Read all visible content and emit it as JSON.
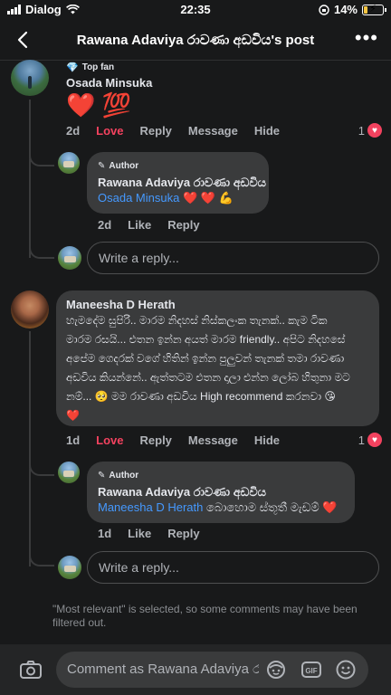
{
  "status_bar": {
    "carrier": "Dialog",
    "time": "22:35",
    "battery": "14%"
  },
  "header": {
    "title": "Rawana Adaviya රාවණා අඩවිය's post"
  },
  "comments": [
    {
      "badge": "Top fan",
      "author": "Osada Minsuka",
      "text": "❤️ 💯",
      "time": "2d",
      "actions": {
        "love": "Love",
        "reply": "Reply",
        "message": "Message",
        "hide": "Hide"
      },
      "reaction_count": "1",
      "reply": {
        "badge": "Author",
        "author": "Rawana Adaviya රාවණා අඩවිය",
        "mention": "Osada Minsuka",
        "text": "❤️ ❤️ 💪",
        "time": "2d",
        "actions": {
          "like": "Like",
          "reply": "Reply"
        }
      },
      "reply_placeholder": "Write a reply..."
    },
    {
      "author": "Maneesha D Herath",
      "lines": [
        "හැමදේම සුපිරි.. මාරම නිදහස් නිස්කලංක තැනක්.. කැම ටික",
        "මාරම රසයි... එතන ඉන්න අයත් මාරම friendly.. අපිට නිදහසේ",
        "අපේම ගෙදරක් වගේ හිතින් ඉන්න පුලුවන් තැනක් තමා රාවණා",
        "අඩවිය කියන්නේ.. ඇත්තටම එතන දාලා එන්න ලෝබ හිතුනා මට",
        "නම්... 🥺 මම රාවණා අඩවිය High recommend කරනවා 😘",
        "❤️"
      ],
      "time": "1d",
      "actions": {
        "love": "Love",
        "reply": "Reply",
        "message": "Message",
        "hide": "Hide"
      },
      "reaction_count": "1",
      "reply": {
        "badge": "Author",
        "author": "Rawana Adaviya රාවණා අඩවිය",
        "mention": "Maneesha D Herath",
        "text": "බොහොම ස්තූතී මැඩම් ❤️",
        "time": "1d",
        "actions": {
          "like": "Like",
          "reply": "Reply"
        }
      },
      "reply_placeholder": "Write a reply..."
    }
  ],
  "filter_note": "\"Most relevant\" is selected, so some comments may have been filtered out.",
  "composer": {
    "placeholder": "Comment as Rawana Adaviya රාවණා අඩවිය"
  },
  "colors": {
    "love": "#f3425f",
    "link": "#4599ff",
    "bubble": "#3a3b3c",
    "background": "#18191a"
  }
}
